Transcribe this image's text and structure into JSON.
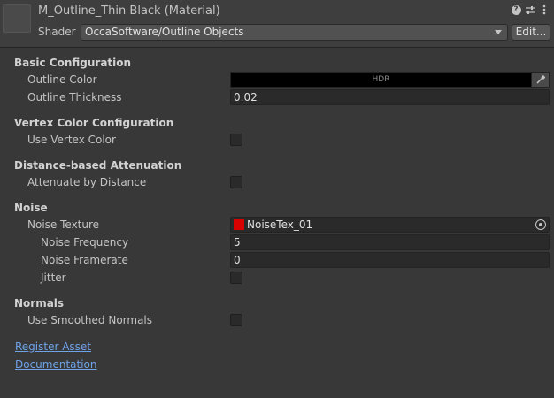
{
  "header": {
    "title": "M_Outline_Thin Black (Material)",
    "shader_label": "Shader",
    "shader_value": "OccaSoftware/Outline Objects",
    "edit_label": "Edit..."
  },
  "sections": {
    "basic": "Basic Configuration",
    "vertex": "Vertex Color Configuration",
    "distance": "Distance-based Attenuation",
    "noise": "Noise",
    "normals": "Normals"
  },
  "fields": {
    "outline_color_label": "Outline Color",
    "outline_color_tag": "HDR",
    "outline_thickness_label": "Outline Thickness",
    "outline_thickness_value": "0.02",
    "use_vertex_color_label": "Use Vertex Color",
    "attenuate_label": "Attenuate by Distance",
    "noise_texture_label": "Noise Texture",
    "noise_texture_value": "NoiseTex_01",
    "noise_frequency_label": "Noise Frequency",
    "noise_frequency_value": "5",
    "noise_framerate_label": "Noise Framerate",
    "noise_framerate_value": "0",
    "jitter_label": "Jitter",
    "smoothed_normals_label": "Use Smoothed Normals"
  },
  "links": {
    "register": "Register Asset",
    "docs": "Documentation"
  },
  "colors": {
    "background": "#383838",
    "outline_color": "#000000",
    "noise_swatch": "#d90000",
    "link": "#6fa3e8"
  }
}
